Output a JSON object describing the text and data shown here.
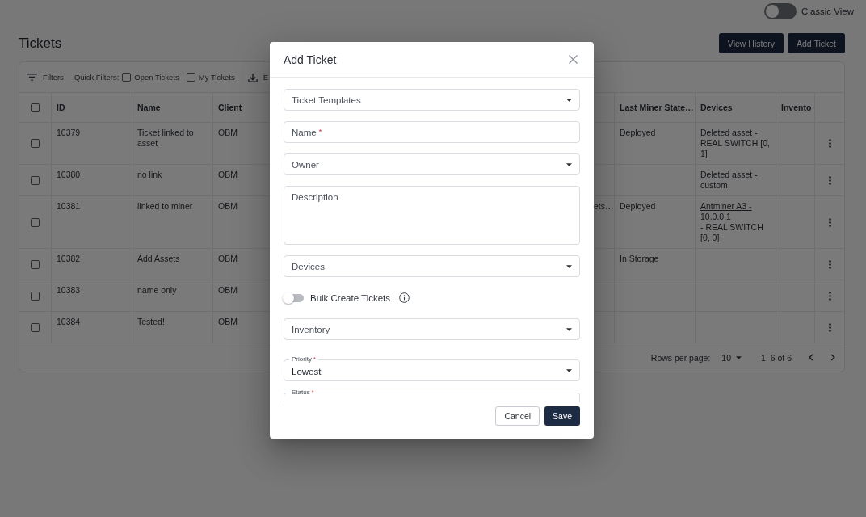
{
  "top_bar": {
    "classic_view": {
      "label": "Classic View",
      "on": false
    }
  },
  "header": {
    "title": "Tickets",
    "buttons": [
      "View History",
      "Add Ticket"
    ]
  },
  "table": {
    "toolbar": {
      "filters": "Filters",
      "quick_filters_label": "Quick Filters:",
      "quick_filters": [
        {
          "label": "Open Tickets",
          "checked": false
        },
        {
          "label": "My Tickets",
          "checked": false
        }
      ],
      "export": "E"
    },
    "all_selected": false,
    "columns": [
      "ID",
      "Name",
      "Client",
      "Last Miner State…",
      "Devices",
      "Invento"
    ],
    "rows": [
      {
        "selected": false,
        "id": "10379",
        "name": "Ticket linked to asset",
        "client": "OBM",
        "last_miner_state": "Deployed",
        "devices": {
          "link": "Deleted asset",
          "rest": "- REAL SWITCH [0, 1]"
        }
      },
      {
        "selected": false,
        "id": "10380",
        "name": "no link",
        "client": "OBM",
        "devices": {
          "link": "Deleted asset",
          "rest": "- custom"
        }
      },
      {
        "selected": false,
        "id": "10381",
        "name": "linked to miner",
        "client": "OBM",
        "column_5": "ets…",
        "last_miner_state": "Deployed",
        "devices": {
          "link": "Antminer A3 - 10.0.0.1",
          "rest": "- REAL SWITCH [0, 0]"
        }
      },
      {
        "selected": false,
        "id": "10382",
        "name": "Add Assets",
        "client": "OBM",
        "last_miner_state": "In Storage"
      },
      {
        "selected": false,
        "id": "10383",
        "name": "name only",
        "client": "OBM"
      },
      {
        "selected": false,
        "id": "10384",
        "name": "Tested!",
        "client": "OBM"
      }
    ],
    "pagination": {
      "rows_per_page_label": "Rows per page:",
      "rows_per_page": "10",
      "range": "1–6 of 6"
    }
  },
  "dialog": {
    "title": "Add Ticket",
    "fields": [
      {
        "kind": "select",
        "label": "Ticket Templates"
      },
      {
        "kind": "text",
        "label": "Name",
        "required_mark": "*"
      },
      {
        "kind": "select",
        "label": "Owner"
      },
      {
        "kind": "textarea",
        "label": "Description"
      },
      {
        "kind": "select",
        "label": "Devices"
      },
      {
        "kind": "switch",
        "label": "Bulk Create Tickets",
        "on": false
      },
      {
        "kind": "select",
        "label": "Inventory"
      },
      {
        "kind": "select",
        "label": "Priority",
        "required_mark": "*",
        "floating_label": true,
        "value": "Lowest"
      },
      {
        "kind": "select",
        "label": "Status",
        "required_mark": "*",
        "floating_label": true
      }
    ],
    "buttons": [
      {
        "kind": "secondary",
        "label": "Cancel"
      },
      {
        "kind": "primary",
        "label": "Save"
      }
    ]
  }
}
